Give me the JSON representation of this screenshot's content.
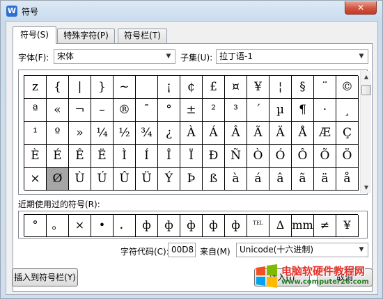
{
  "window": {
    "title": "符号",
    "app_icon_letter": "W",
    "close_glyph": "✕"
  },
  "tabs": [
    {
      "label": "符号(S)",
      "active": true
    },
    {
      "label": "特殊字符(P)",
      "active": false
    },
    {
      "label": "符号栏(T)",
      "active": false
    }
  ],
  "font_label": "字体(F):",
  "font_value": "宋体",
  "subset_label": "子集(U):",
  "subset_value": "拉丁语-1",
  "symbols": [
    "z",
    "{",
    "|",
    "}",
    "~",
    " ",
    "¡",
    "¢",
    "£",
    "¤",
    "¥",
    "¦",
    "§",
    "¨",
    "©",
    "ª",
    "«",
    "¬",
    "–",
    "®",
    "¯",
    "°",
    "±",
    "²",
    "³",
    "´",
    "µ",
    "¶",
    "·",
    "¸",
    "¹",
    "º",
    "»",
    "¼",
    "½",
    "¾",
    "¿",
    "À",
    "Á",
    "Â",
    "Ã",
    "Ä",
    "Å",
    "Æ",
    "Ç",
    "È",
    "É",
    "Ê",
    "Ë",
    "Ì",
    "Í",
    "Î",
    "Ï",
    "Ð",
    "Ñ",
    "Ò",
    "Ó",
    "Ô",
    "Õ",
    "Ö",
    "×",
    "Ø",
    "Ù",
    "Ú",
    "Û",
    "Ü",
    "Ý",
    "Þ",
    "ß",
    "à",
    "á",
    "â",
    "ã",
    "ä",
    "å"
  ],
  "selected_symbol": "Ø",
  "recent_label": "近期使用过的符号(R):",
  "recent_symbols": [
    "°",
    "。",
    "×",
    "•",
    "．",
    "ф",
    "ф",
    "ф",
    "ф",
    "ф",
    "TEL",
    "Δ",
    "mm",
    "≠",
    "¥"
  ],
  "char_code_label": "字符代码(C):",
  "char_code_value": "00D8",
  "from_label": "来自(M)",
  "from_value": "Unicode(十六进制)",
  "buttons": {
    "insert_to_bar": "插入到符号栏(Y)",
    "insert": "插入(I)",
    "cancel": "取消"
  },
  "watermark": {
    "text": "电脑软硬件教程网",
    "url": "www.computer26.com"
  }
}
